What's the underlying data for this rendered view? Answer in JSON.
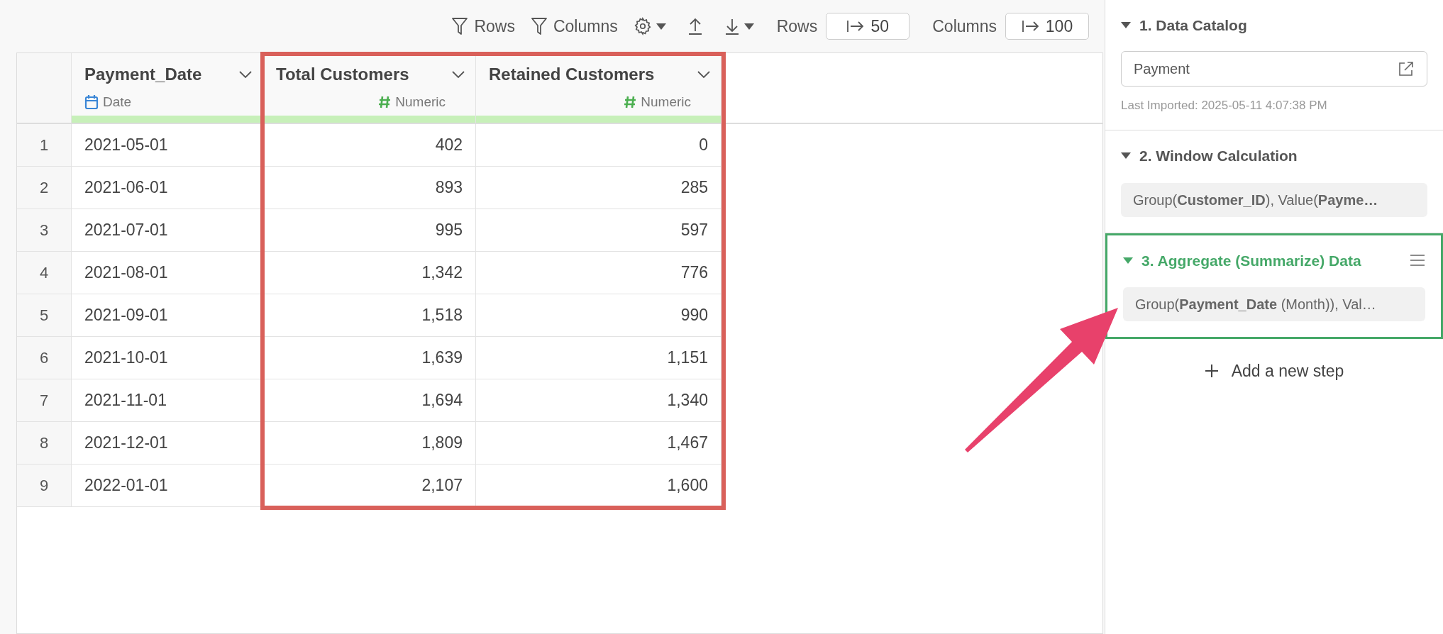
{
  "toolbar": {
    "row_filter": "Rows",
    "column_filter": "Columns",
    "rows_label": "Rows",
    "rows_limit": "50",
    "columns_label": "Columns",
    "columns_limit": "100"
  },
  "table": {
    "columns": [
      {
        "name": "Payment_Date",
        "kind": "date",
        "type_label": "Date",
        "highlighted": false
      },
      {
        "name": "Total Customers",
        "kind": "numeric",
        "type_label": "Numeric",
        "highlighted": true
      },
      {
        "name": "Retained Customers",
        "kind": "numeric",
        "type_label": "Numeric",
        "highlighted": true
      }
    ],
    "rows": [
      {
        "index": "1",
        "cells": [
          "2021-05-01",
          "402",
          "0"
        ]
      },
      {
        "index": "2",
        "cells": [
          "2021-06-01",
          "893",
          "285"
        ]
      },
      {
        "index": "3",
        "cells": [
          "2021-07-01",
          "995",
          "597"
        ]
      },
      {
        "index": "4",
        "cells": [
          "2021-08-01",
          "1,342",
          "776"
        ]
      },
      {
        "index": "5",
        "cells": [
          "2021-09-01",
          "1,518",
          "990"
        ]
      },
      {
        "index": "6",
        "cells": [
          "2021-10-01",
          "1,639",
          "1,151"
        ]
      },
      {
        "index": "7",
        "cells": [
          "2021-11-01",
          "1,694",
          "1,340"
        ]
      },
      {
        "index": "8",
        "cells": [
          "2021-12-01",
          "1,809",
          "1,467"
        ]
      },
      {
        "index": "9",
        "cells": [
          "2022-01-01",
          "2,107",
          "1,600"
        ]
      }
    ]
  },
  "steps": [
    {
      "kind": "source",
      "title": "1. Data Catalog",
      "selected": false,
      "expanded": true,
      "source": "Payment",
      "note": "Last Imported: 2025-05-11 4:07:38 PM"
    },
    {
      "kind": "summary",
      "title": "2. Window Calculation",
      "selected": false,
      "expanded": true,
      "summary": "Group(**Customer_ID**), Value(**Payme…**"
    },
    {
      "kind": "summary",
      "title": "3. Aggregate (Summarize) Data",
      "selected": true,
      "expanded": true,
      "summary": "Group(**Payment_Date** (Month)), Val…"
    }
  ],
  "add_step": "Add a new step"
}
